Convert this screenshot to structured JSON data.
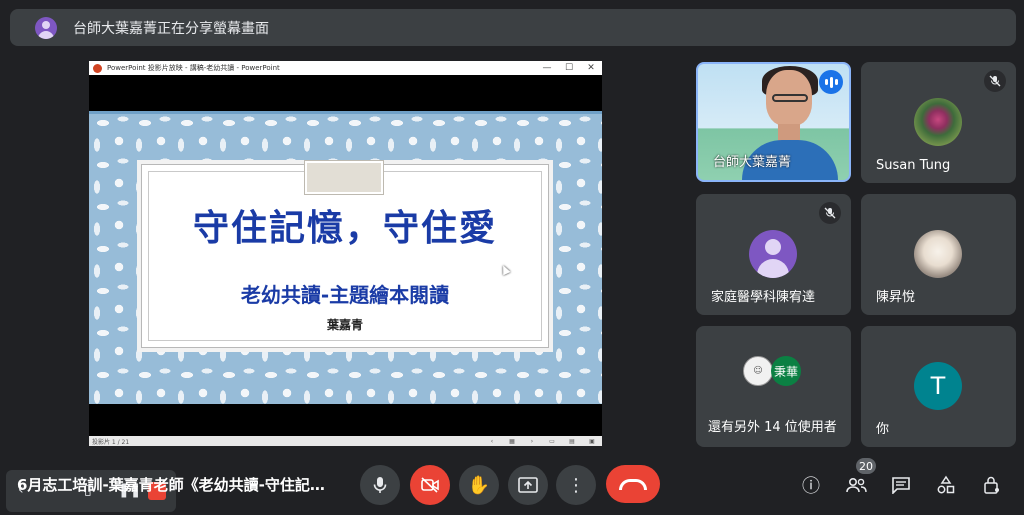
{
  "banner": {
    "text": "台師大葉嘉菁正在分享螢幕畫面",
    "avatar_icon": "person-icon"
  },
  "presentation": {
    "window_title": "PowerPoint 投影片放映 - 講稿-老幼共讀 - PowerPoint",
    "window_controls": [
      "—",
      "☐",
      "✕"
    ],
    "slide": {
      "title": "守住記憶，守住愛",
      "subtitle": "老幼共讀-主題繪本閱讀",
      "author": "葉嘉青"
    },
    "status_text": "投影片 1 / 21"
  },
  "participants": [
    {
      "name": "台師大葉嘉菁",
      "speaking": true
    },
    {
      "name": "Susan Tung",
      "muted": true
    },
    {
      "name": "家庭醫學科陳宥達",
      "muted": true
    },
    {
      "name": "陳昇悅"
    },
    {
      "name": "還有另外 14 位使用者",
      "other_initials": "秉華"
    },
    {
      "name": "你",
      "initial": "T"
    }
  ],
  "bottom": {
    "meeting_title": "6月志工培訓-葉嘉青老師《老幼共讀-守住記…",
    "participants_count": "20"
  },
  "colors": {
    "accent": "#8ab4f8",
    "end_call": "#ea4335",
    "tile": "#3c4043",
    "bg": "#202124",
    "slide_text": "#1a3ba6"
  }
}
